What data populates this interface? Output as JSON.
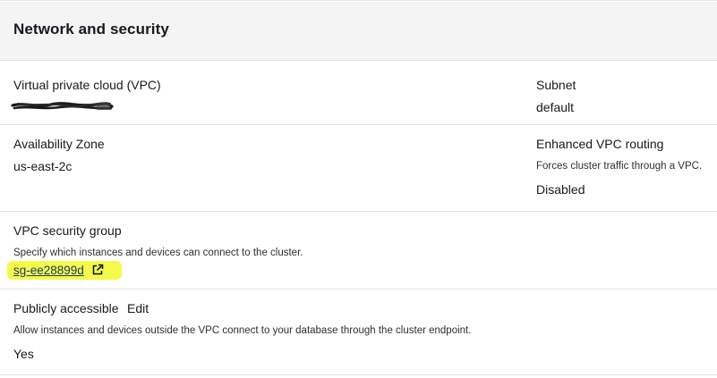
{
  "section": {
    "title": "Network and security"
  },
  "vpc": {
    "label": "Virtual private cloud (VPC)",
    "value": ""
  },
  "subnet": {
    "label": "Subnet",
    "value": "default"
  },
  "availability_zone": {
    "label": "Availability Zone",
    "value": "us-east-2c"
  },
  "enhanced_vpc_routing": {
    "label": "Enhanced VPC routing",
    "description": "Forces cluster traffic through a VPC.",
    "value": "Disabled"
  },
  "security_group": {
    "label": "VPC security group",
    "description": "Specify which instances and devices can connect to the cluster.",
    "link_text": "sg-ee28899d",
    "link_icon": "external-link-icon",
    "highlight_color": "#f4f94a"
  },
  "publicly_accessible": {
    "label": "Publicly accessible",
    "edit_label": "Edit",
    "description": "Allow instances and devices outside the VPC connect to your database through the cluster endpoint.",
    "value": "Yes"
  }
}
